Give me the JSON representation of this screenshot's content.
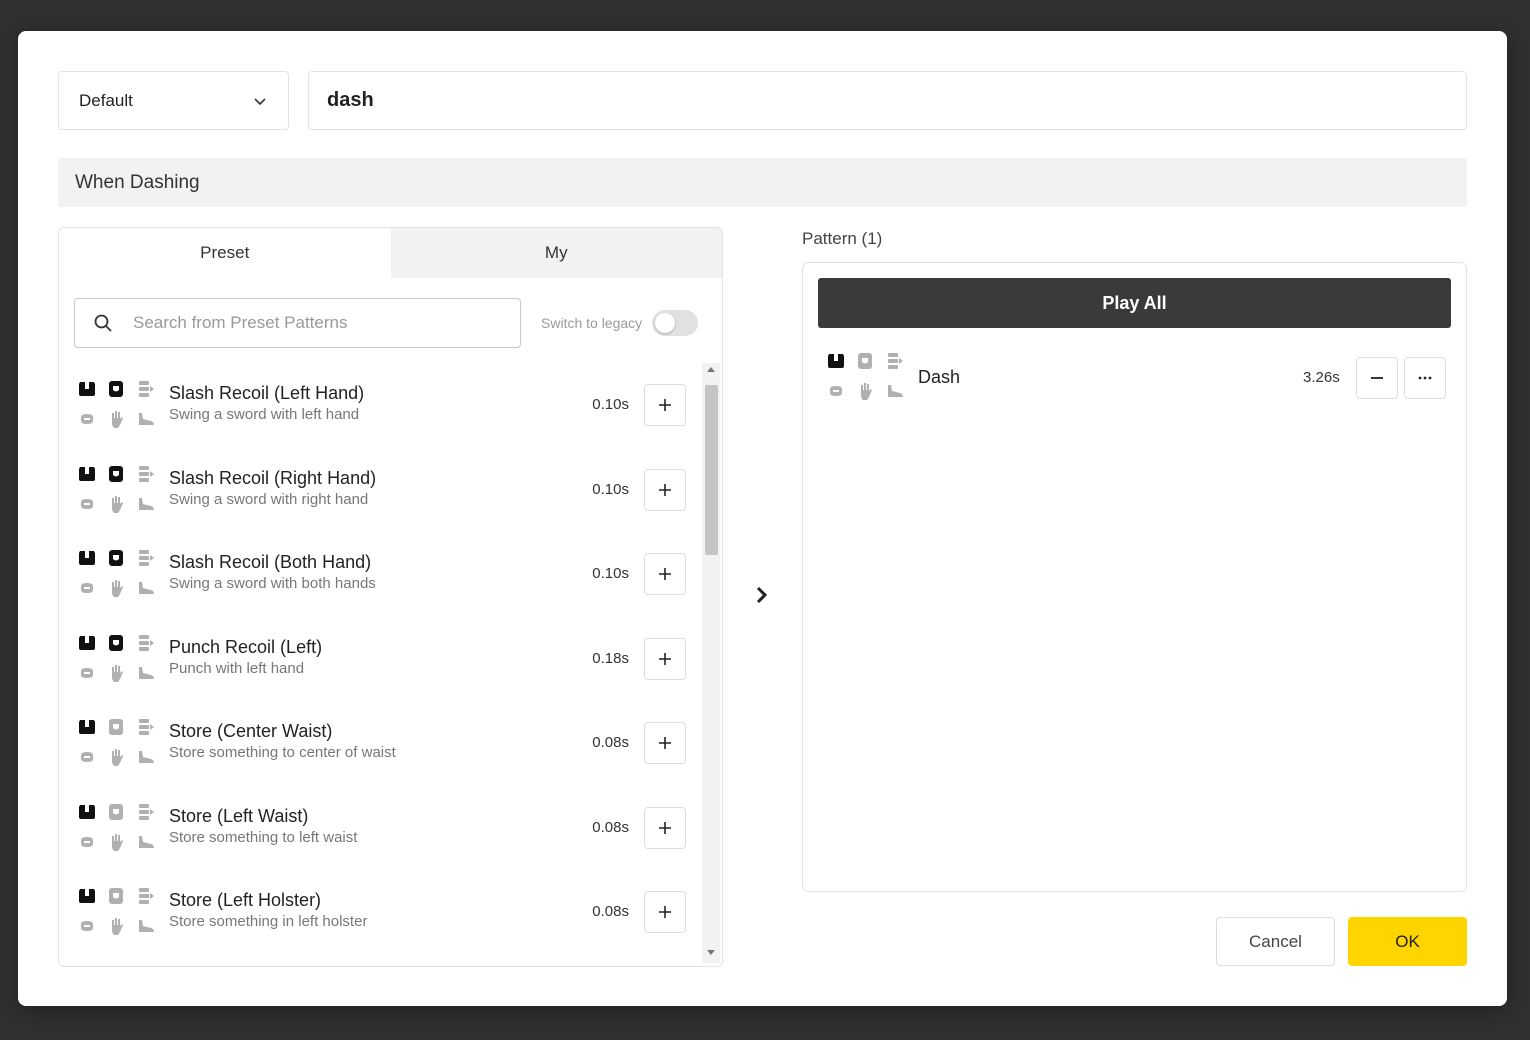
{
  "preset_select": {
    "value": "Default",
    "icon": "chevron-down-icon"
  },
  "name_input": {
    "value": "dash"
  },
  "section": {
    "title": "When Dashing"
  },
  "tabs": [
    {
      "label": "Preset",
      "active": true
    },
    {
      "label": "My",
      "active": false
    }
  ],
  "search": {
    "placeholder": "Search from Preset Patterns",
    "icon": "search-icon"
  },
  "legacy": {
    "label": "Switch to legacy",
    "enabled": false
  },
  "presets": [
    {
      "title": "Slash Recoil (Left Hand)",
      "desc": "Swing a sword with left hand",
      "duration": "0.10s",
      "device_active": true
    },
    {
      "title": "Slash Recoil (Right Hand)",
      "desc": "Swing a sword with right hand",
      "duration": "0.10s",
      "device_active": true
    },
    {
      "title": "Slash Recoil (Both Hand)",
      "desc": "Swing a sword with both hands",
      "duration": "0.10s",
      "device_active": true
    },
    {
      "title": "Punch Recoil (Left)",
      "desc": "Punch with left hand",
      "duration": "0.18s",
      "device_active": true
    },
    {
      "title": "Store (Center Waist)",
      "desc": "Store something to center of waist",
      "duration": "0.08s",
      "device_active": false
    },
    {
      "title": "Store (Left Waist)",
      "desc": "Store something to left waist",
      "duration": "0.08s",
      "device_active": false
    },
    {
      "title": "Store (Left Holster)",
      "desc": "Store something in left holster",
      "duration": "0.08s",
      "device_active": false
    }
  ],
  "pattern": {
    "label": "Pattern (1)",
    "play_all": "Play All",
    "items": [
      {
        "name": "Dash",
        "duration": "3.26s"
      }
    ]
  },
  "footer": {
    "cancel": "Cancel",
    "ok": "OK"
  },
  "colors": {
    "ok": "#ffd500",
    "play_all": "#3a3a3a",
    "backdrop": "#303030"
  }
}
